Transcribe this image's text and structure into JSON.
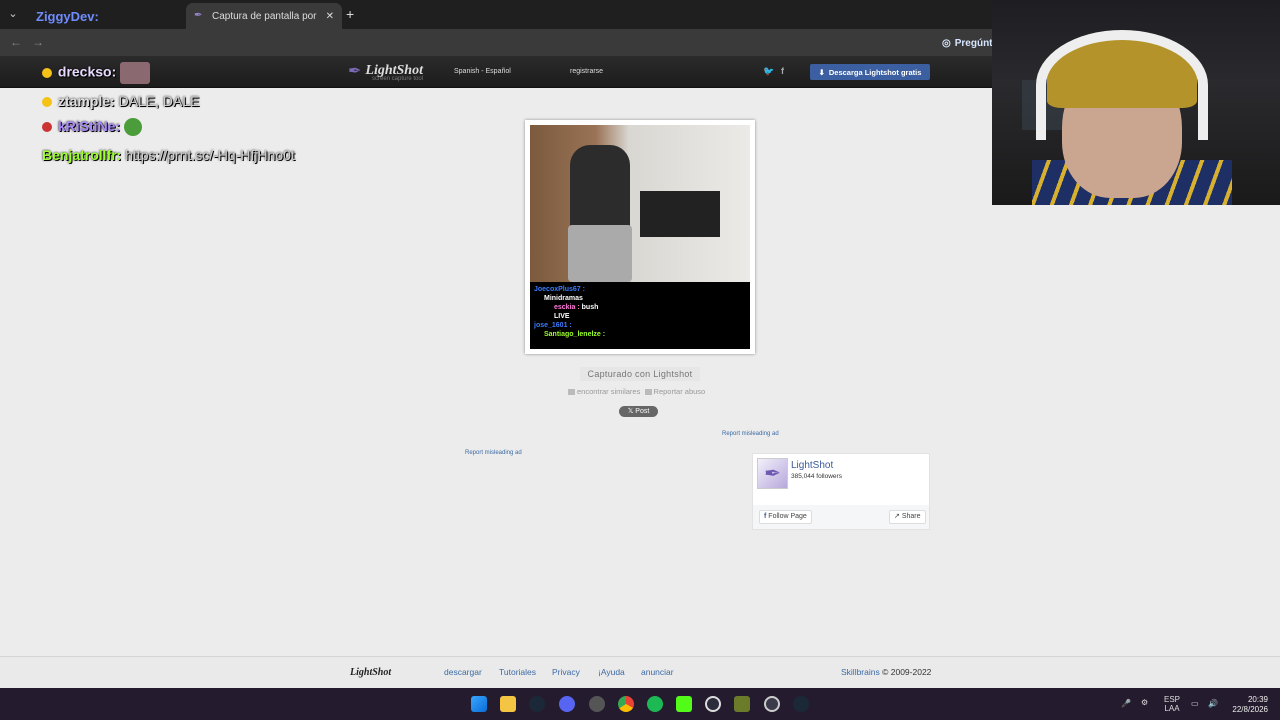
{
  "browser": {
    "inactive_tab_title": "ZiggyDev:",
    "active_tab_title": "Captura de pantalla por Lightsh",
    "ask_button": "Pregúnta"
  },
  "lightshot": {
    "brand": "LightShot",
    "tagline": "screen capture tool",
    "language": "Spanish - Español",
    "register": "registrarse",
    "download_button": "Descarga Lightshot gratis",
    "caption": "Capturado con Lightshot",
    "find_similar": "encontrar similares",
    "report_abuse": "Reportar abuso",
    "x_post": "Post",
    "report_ad_1": "Report misleading ad",
    "report_ad_2": "Report misleading ad",
    "facebook": {
      "name": "LightShot",
      "followers": "385,044 followers",
      "follow_button": "Follow Page",
      "share_button": "Share"
    },
    "footer": {
      "logo": "LightShot",
      "links": [
        "descargar",
        "Tutoriales",
        "Privacy",
        "¡Ayuda",
        "anunciar"
      ],
      "company": "Skillbrains",
      "copyright": "© 2009-2022"
    }
  },
  "overlay_chat": [
    {
      "user": "drecksо:",
      "text": "",
      "color": "#e8d9ff"
    },
    {
      "user": "ztample:",
      "text": "DALE, DALE",
      "color": "#e0e0e0"
    },
    {
      "user": "kRiStiNe:",
      "text": "",
      "color": "#a98aff"
    },
    {
      "user": "Benjatrollfr:",
      "text": "https://prnt.sc/-Hq-HfjHno0t",
      "color": "#9dff2e"
    }
  ],
  "screenshot_chat": [
    {
      "user": "JoecoxPlus67 :",
      "text": "",
      "color": "#3b7bff"
    },
    {
      "user": "Minidramas",
      "text": "",
      "color": "#ffffff"
    },
    {
      "user": "esckia :",
      "text": "bush",
      "color": "#ff7ad9"
    },
    {
      "user": "LIVE",
      "text": "",
      "color": "#ffffff"
    },
    {
      "user": "jose_1601 :",
      "text": "",
      "color": "#3b7bff"
    },
    {
      "user": "Santiago_lenelze :",
      "text": "",
      "color": "#9dff2e"
    }
  ],
  "taskbar": {
    "language": "ESP",
    "layout": "LAA",
    "time": "20:39",
    "date": "22/8/2026"
  }
}
